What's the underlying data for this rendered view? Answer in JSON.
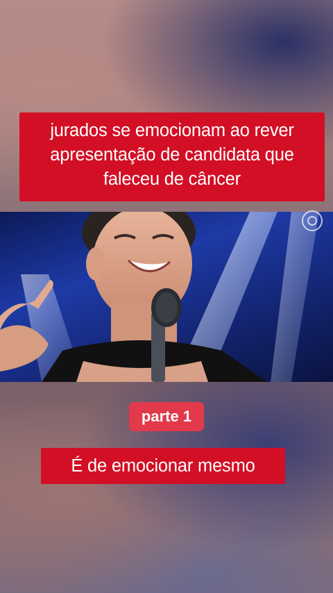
{
  "headline": {
    "lines": [
      "jurados se emocionam ao rever",
      "apresentação de candidata que",
      "faleceu de câncer"
    ]
  },
  "video": {
    "description_icon": "network-logo-icon"
  },
  "part_badge": {
    "label": "parte 1"
  },
  "caption": {
    "text": "É de emocionar mesmo"
  },
  "colors": {
    "caption_red": "#d20f25",
    "badge_red": "#e2394b"
  }
}
